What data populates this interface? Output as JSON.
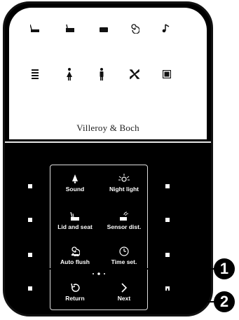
{
  "brand": "Villeroy & Boch",
  "top_icons": [
    "lid-open-icon",
    "lid-closed-icon",
    "flush-icon",
    "spiral-icon",
    "music-note-icon",
    "seat-heat-icon",
    "woman-icon",
    "man-icon",
    "fan-icon",
    "stop-icon"
  ],
  "menu": [
    {
      "label": "Sound",
      "icon": "bell-icon"
    },
    {
      "label": "Night light",
      "icon": "light-icon"
    },
    {
      "label": "Lid and seat",
      "icon": "lid-seat-icon"
    },
    {
      "label": "Sensor dist.",
      "icon": "sensor-icon"
    },
    {
      "label": "Auto flush",
      "icon": "auto-flush-icon"
    },
    {
      "label": "Time set.",
      "icon": "clock-icon"
    }
  ],
  "nav": {
    "return_label": "Return",
    "next_label": "Next"
  },
  "callouts": [
    "1",
    "2"
  ],
  "colors": {
    "body": "#000000",
    "top_panel": "#ffffff",
    "text_light": "#ffffff"
  }
}
